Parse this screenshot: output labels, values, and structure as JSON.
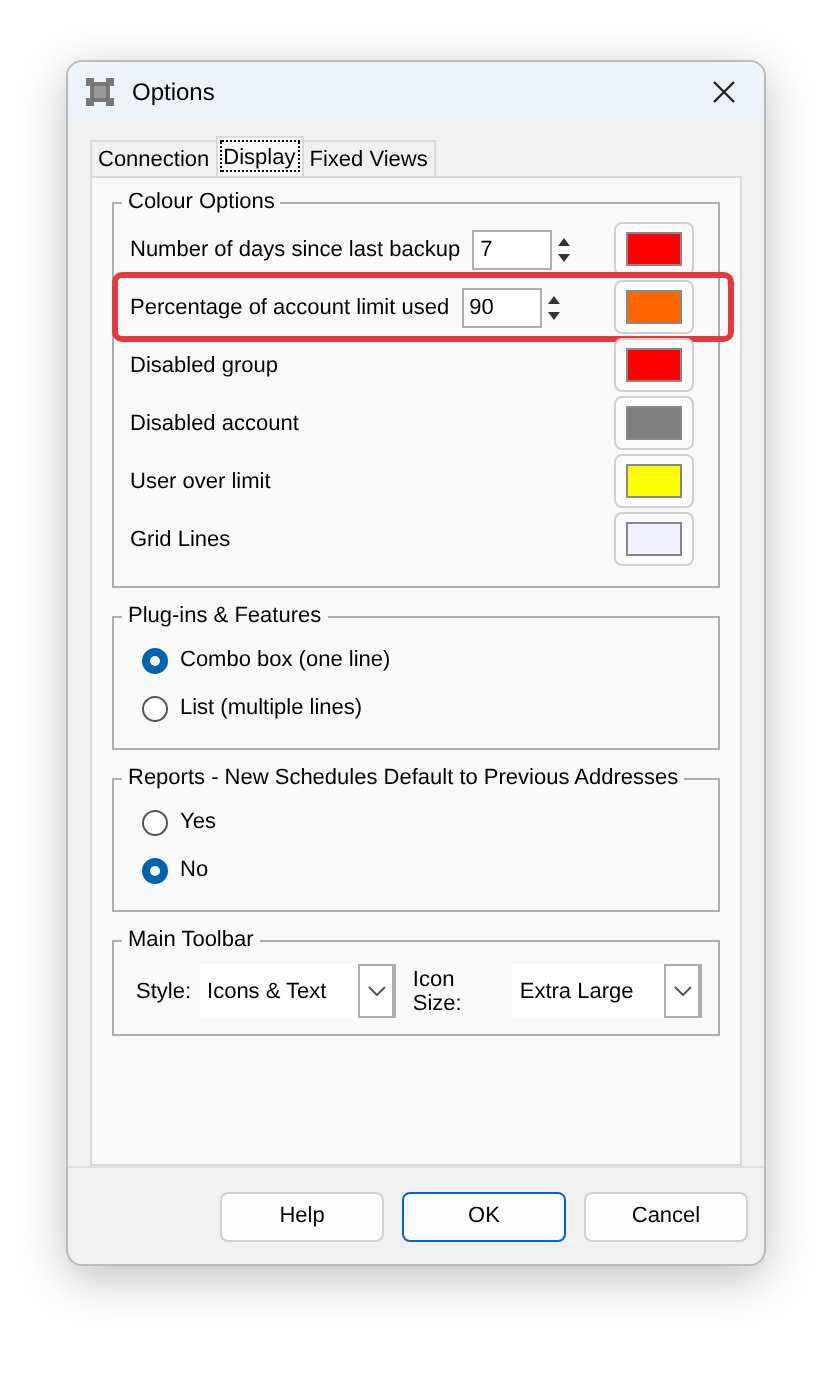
{
  "window": {
    "title": "Options"
  },
  "tabs": [
    {
      "label": "Connection",
      "selected": false
    },
    {
      "label": "Display",
      "selected": true
    },
    {
      "label": "Fixed Views",
      "selected": false
    }
  ],
  "colour_options": {
    "title": "Colour Options",
    "rows": [
      {
        "kind": "spinner",
        "label": "Number of days since last backup",
        "value": "7",
        "color": "#ff0000",
        "highlighted": false
      },
      {
        "kind": "spinner",
        "label": "Percentage of account limit used",
        "value": "90",
        "color": "#ff6600",
        "highlighted": true
      },
      {
        "kind": "plain",
        "label": "Disabled group",
        "color": "#ff0000",
        "highlighted": false
      },
      {
        "kind": "plain",
        "label": "Disabled account",
        "color": "#808080",
        "highlighted": false
      },
      {
        "kind": "plain",
        "label": "User over limit",
        "color": "#ffff00",
        "highlighted": false
      },
      {
        "kind": "plain",
        "label": "Grid Lines",
        "color": "#f0f0ff",
        "highlighted": false
      }
    ]
  },
  "plugins": {
    "title": "Plug-ins & Features",
    "options": [
      {
        "label": "Combo box (one line)",
        "selected": true
      },
      {
        "label": "List (multiple lines)",
        "selected": false
      }
    ]
  },
  "reports": {
    "title": "Reports - New Schedules Default to Previous Addresses",
    "options": [
      {
        "label": "Yes",
        "selected": false
      },
      {
        "label": "No",
        "selected": true
      }
    ]
  },
  "toolbar": {
    "title": "Main Toolbar",
    "style_label": "Style:",
    "style_value": "Icons & Text",
    "size_label": "Icon Size:",
    "size_value": "Extra Large"
  },
  "buttons": [
    {
      "label": "Help",
      "default": false
    },
    {
      "label": "OK",
      "default": true
    },
    {
      "label": "Cancel",
      "default": false
    }
  ]
}
